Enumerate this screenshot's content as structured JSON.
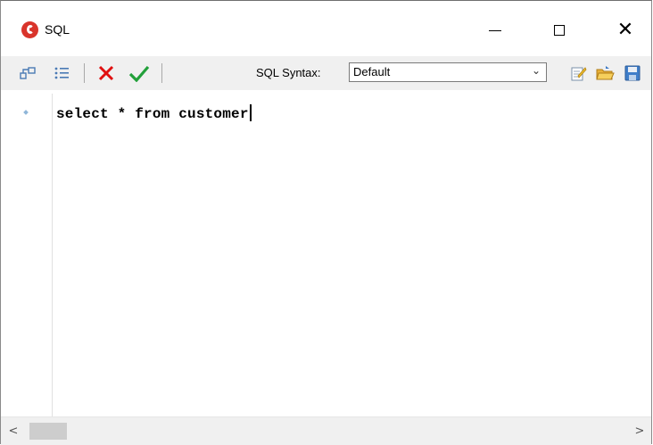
{
  "window": {
    "title": "SQL"
  },
  "toolbar": {
    "syntax_label": "SQL Syntax:",
    "syntax_value": "Default",
    "icons": [
      "tree-view-icon",
      "list-icon",
      "cancel-icon",
      "confirm-icon",
      "edit-icon",
      "open-folder-icon",
      "save-icon"
    ]
  },
  "editor": {
    "code": "select * from customer"
  },
  "colors": {
    "cancel": "#e01010",
    "confirm": "#22a03a",
    "app_icon": "#d9342b"
  }
}
